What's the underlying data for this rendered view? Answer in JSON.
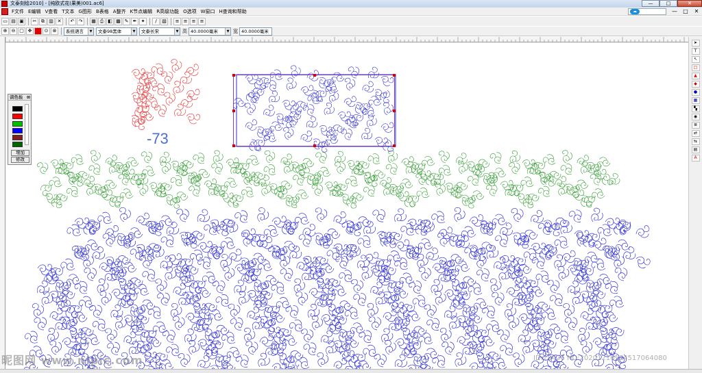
{
  "titlebar": {
    "title": "文泰刻绘2010] - [纯欧式花(果美)001.ac6]",
    "minimize": "—",
    "maximize": "□",
    "close": "✕"
  },
  "menubar": {
    "items": [
      "F文件",
      "E编辑",
      "V查看",
      "T文本",
      "G图形",
      "B表格",
      "A整齐",
      "K节点编辑",
      "R高级功能",
      "O选项",
      "W窗口",
      "H查询和帮助"
    ],
    "right_minimize": "—",
    "right_restore": "□",
    "right_close": "✕"
  },
  "toolbar2": {
    "language": "系统语言",
    "font": "文泰98黑体",
    "style": "文泰长宋",
    "height_label": "高",
    "height_value": "40.0000毫米",
    "width_label": "宽",
    "width_value": "40.0000毫米"
  },
  "palette": {
    "title": "调色板",
    "close": "⊠",
    "swatches": [
      "#000000",
      "#ff0000",
      "#00c000",
      "#0000ff",
      "#802020",
      "#006400"
    ],
    "add_button": "增加",
    "edit_button": "修改"
  },
  "canvas": {
    "label_value": "-73",
    "colors": {
      "red_ornament": "#e83030",
      "blue_ornament": "#2c2cd8",
      "green_ornament": "#2e9a2e",
      "selection_handle": "#dd0000"
    }
  },
  "watermarks": {
    "left": "昵图网 www.nipic.com",
    "right": "ID:28426 NO:20201216184517064080"
  }
}
